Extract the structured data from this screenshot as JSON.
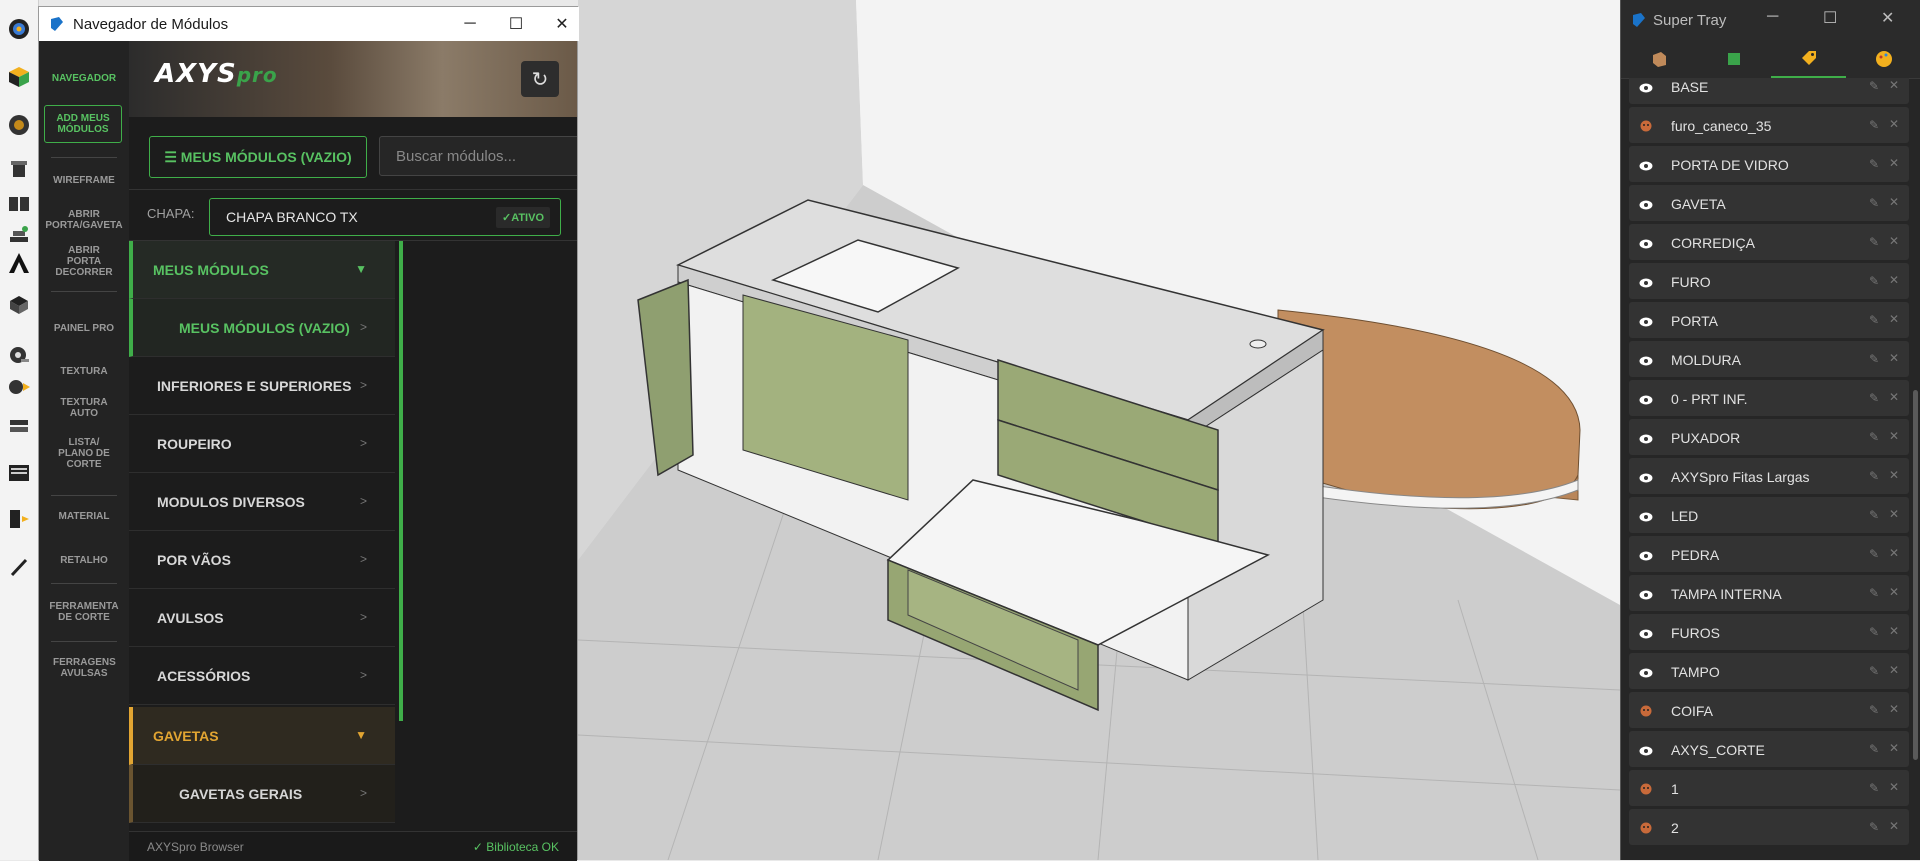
{
  "nav_window": {
    "title": "Navegador de Módulos",
    "rail": [
      "NAVEGADOR",
      "ADD MEUS MÓDULOS",
      "WIREFRAME",
      "ABRIR PORTA/GAVETA",
      "ABRIR PORTA DECORRER",
      "PAINEL PRO",
      "TEXTURA",
      "TEXTURA AUTO",
      "LISTA/ PLANO DE CORTE",
      "MATERIAL",
      "RETALHO",
      "FERRAMENTA DE CORTE",
      "FERRAGENS AVULSAS"
    ],
    "logo": "AXYS",
    "logo_suffix": "pro",
    "mods_button": "☰ MEUS MÓDULOS (VAZIO)",
    "search_placeholder": "Buscar módulos...",
    "chapa_label": "CHAPA:",
    "chapa_value": "CHAPA BRANCO TX",
    "chapa_status": "✓ATIVO",
    "menu": [
      {
        "label": "MEUS MÓDULOS",
        "arrow": "▼"
      },
      {
        "label": "MEUS MÓDULOS (VAZIO)",
        "arrow": ">"
      },
      {
        "label": "INFERIORES E SUPERIORES",
        "arrow": ">"
      },
      {
        "label": "ROUPEIRO",
        "arrow": ">"
      },
      {
        "label": "MODULOS DIVERSOS",
        "arrow": ">"
      },
      {
        "label": "POR VÃOS",
        "arrow": ">"
      },
      {
        "label": "AVULSOS",
        "arrow": ">"
      },
      {
        "label": "ACESSÓRIOS",
        "arrow": ">"
      },
      {
        "label": "GAVETAS",
        "arrow": "▼"
      },
      {
        "label": "GAVETAS GERAIS",
        "arrow": ">"
      }
    ],
    "status_left": "AXYSpro Browser",
    "status_right": "✓ Biblioteca OK"
  },
  "tray": {
    "title": "Super Tray",
    "tags": [
      {
        "name": "BASE",
        "icon": "eye-icon"
      },
      {
        "name": "furo_caneco_35",
        "icon": "monkey-icon"
      },
      {
        "name": "PORTA DE VIDRO",
        "icon": "eye-icon"
      },
      {
        "name": "GAVETA",
        "icon": "eye-icon"
      },
      {
        "name": "CORREDIÇA",
        "icon": "eye-icon"
      },
      {
        "name": "FURO",
        "icon": "eye-icon"
      },
      {
        "name": "PORTA",
        "icon": "eye-icon"
      },
      {
        "name": "MOLDURA",
        "icon": "eye-icon"
      },
      {
        "name": "0 - PRT INF.",
        "icon": "eye-icon"
      },
      {
        "name": "PUXADOR",
        "icon": "eye-icon"
      },
      {
        "name": "AXYSpro Fitas Largas",
        "icon": "eye-icon"
      },
      {
        "name": "LED",
        "icon": "eye-icon"
      },
      {
        "name": "PEDRA",
        "icon": "eye-icon"
      },
      {
        "name": "TAMPA INTERNA",
        "icon": "eye-icon"
      },
      {
        "name": "FUROS",
        "icon": "eye-icon"
      },
      {
        "name": "TAMPO",
        "icon": "eye-icon"
      },
      {
        "name": "COIFA",
        "icon": "monkey-icon"
      },
      {
        "name": "AXYS_CORTE",
        "icon": "eye-icon"
      },
      {
        "name": "1",
        "icon": "monkey-icon"
      },
      {
        "name": "2",
        "icon": "monkey-icon"
      }
    ]
  },
  "colors": {
    "accent_green": "#3fae49",
    "accent_orange": "#e2a532"
  }
}
